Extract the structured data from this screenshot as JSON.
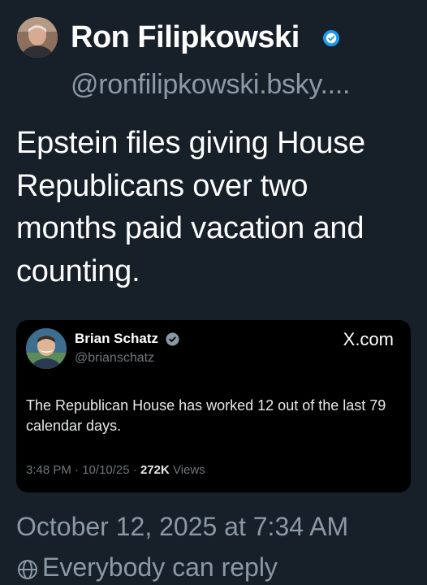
{
  "post": {
    "author": {
      "display_name": "Ron Filipkowski",
      "handle": "@ronfilipkowski.bsky....",
      "verified": true,
      "avatar_icon": "person-avatar"
    },
    "text": "Epstein files giving House Republicans over two months paid vacation and counting.",
    "timestamp": "October 12, 2025 at 7:34 AM",
    "reply_setting": "Everybody can reply"
  },
  "quoted": {
    "author": {
      "display_name": "Brian Schatz",
      "handle": "@brianschatz",
      "verified": true,
      "avatar_icon": "person-avatar"
    },
    "brand": "X.com",
    "text": "The Republican House has worked 12 out of the last 79 calendar days.",
    "time": "3:48 PM",
    "date": "10/10/25",
    "separator": "·",
    "views_count": "272K",
    "views_label": "Views"
  },
  "colors": {
    "background": "#172029",
    "verified_badge": "#1d9bf0",
    "muted_text": "#8b98a5",
    "card_background": "#000000"
  }
}
